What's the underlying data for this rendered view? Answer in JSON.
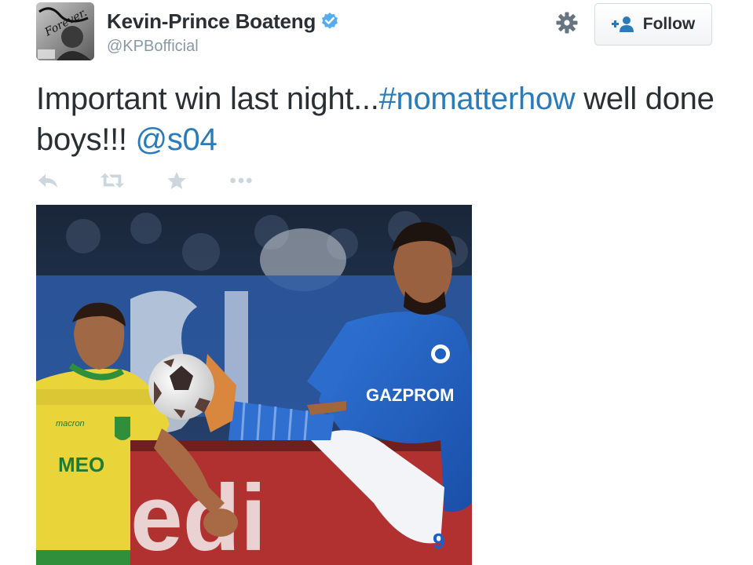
{
  "tweet": {
    "display_name": "Kevin-Prince Boateng",
    "handle": "@KPBofficial",
    "follow_label": "Follow",
    "text_before": "Important win last night...",
    "hashtag": "#nomatterhow",
    "text_middle": " well done boys!!! ",
    "mention": "@s04",
    "avatar_caption": "Forever."
  },
  "photo": {
    "jersey_sponsor": "GAZPROM",
    "opponent_sponsor": "MEO",
    "opponent_brand": "macron",
    "jersey_number": "9",
    "banner_text": "edi"
  },
  "colors": {
    "link": "#2b7bb9",
    "verified": "#55acee",
    "text": "#292f33",
    "muted": "#8899a6",
    "action_icons": "#ccd6dd",
    "schalke_blue": "#1f5fc4",
    "sporting_yellow": "#e9d43a"
  },
  "icons": {
    "verified": "verified-badge-icon",
    "gear": "gear-icon",
    "follow": "add-user-icon",
    "reply": "reply-icon",
    "retweet": "retweet-icon",
    "favorite": "star-icon",
    "more": "more-dots-icon"
  }
}
